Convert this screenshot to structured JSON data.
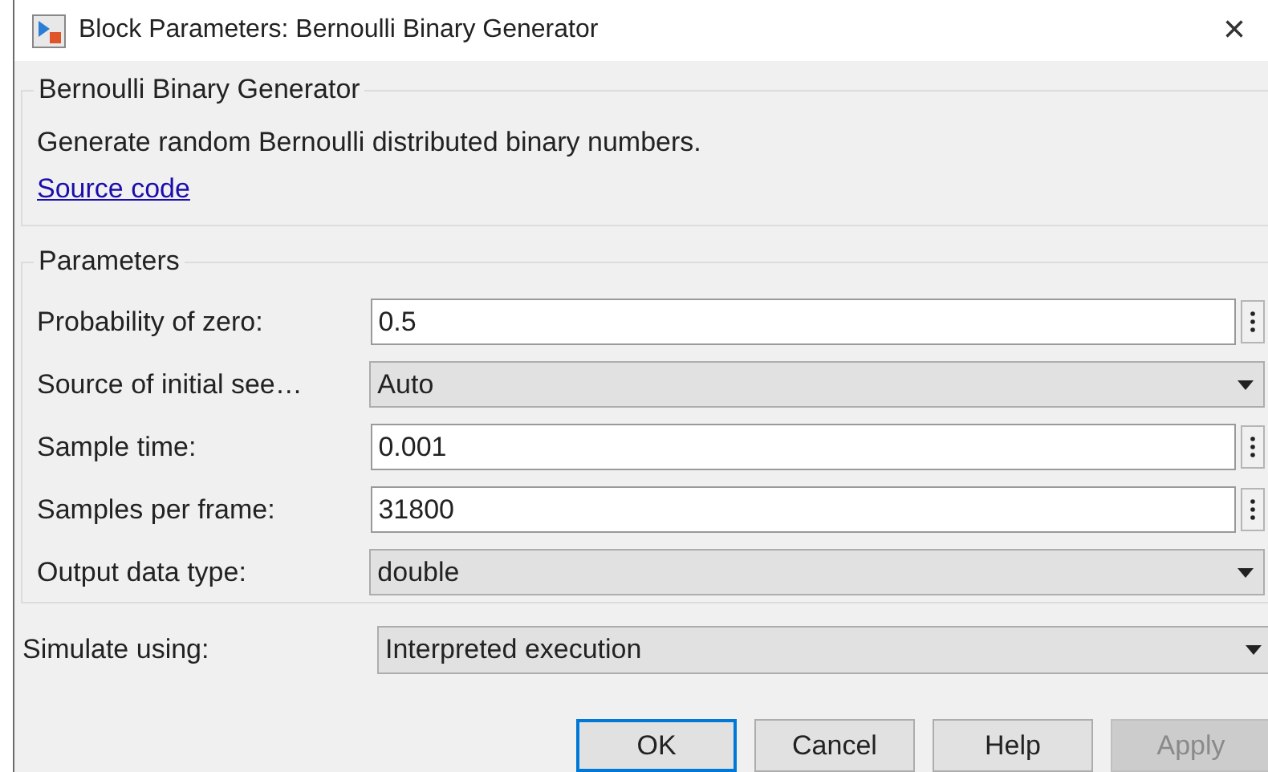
{
  "window": {
    "title": "Block Parameters: Bernoulli Binary Generator",
    "close": "×"
  },
  "description_group": {
    "title": "Bernoulli Binary Generator",
    "text": "Generate random Bernoulli distributed binary numbers.",
    "link": "Source code"
  },
  "parameters_group": {
    "title": "Parameters",
    "rows": [
      {
        "kind": "edit",
        "label": "Probability of zero:",
        "value": "0.5"
      },
      {
        "kind": "dropdown",
        "label": "Source of initial see…",
        "value": "Auto"
      },
      {
        "kind": "edit",
        "label": "Sample time:",
        "value": "0.001"
      },
      {
        "kind": "edit",
        "label": "Samples per frame:",
        "value": "31800"
      },
      {
        "kind": "dropdown",
        "label": "Output data type:",
        "value": "double"
      }
    ]
  },
  "simulate": {
    "label": "Simulate using:",
    "value": "Interpreted execution"
  },
  "buttons": [
    {
      "label": "OK",
      "default": true,
      "disabled": false
    },
    {
      "label": "Cancel",
      "default": false,
      "disabled": false
    },
    {
      "label": "Help",
      "default": false,
      "disabled": false
    },
    {
      "label": "Apply",
      "default": false,
      "disabled": true
    }
  ]
}
